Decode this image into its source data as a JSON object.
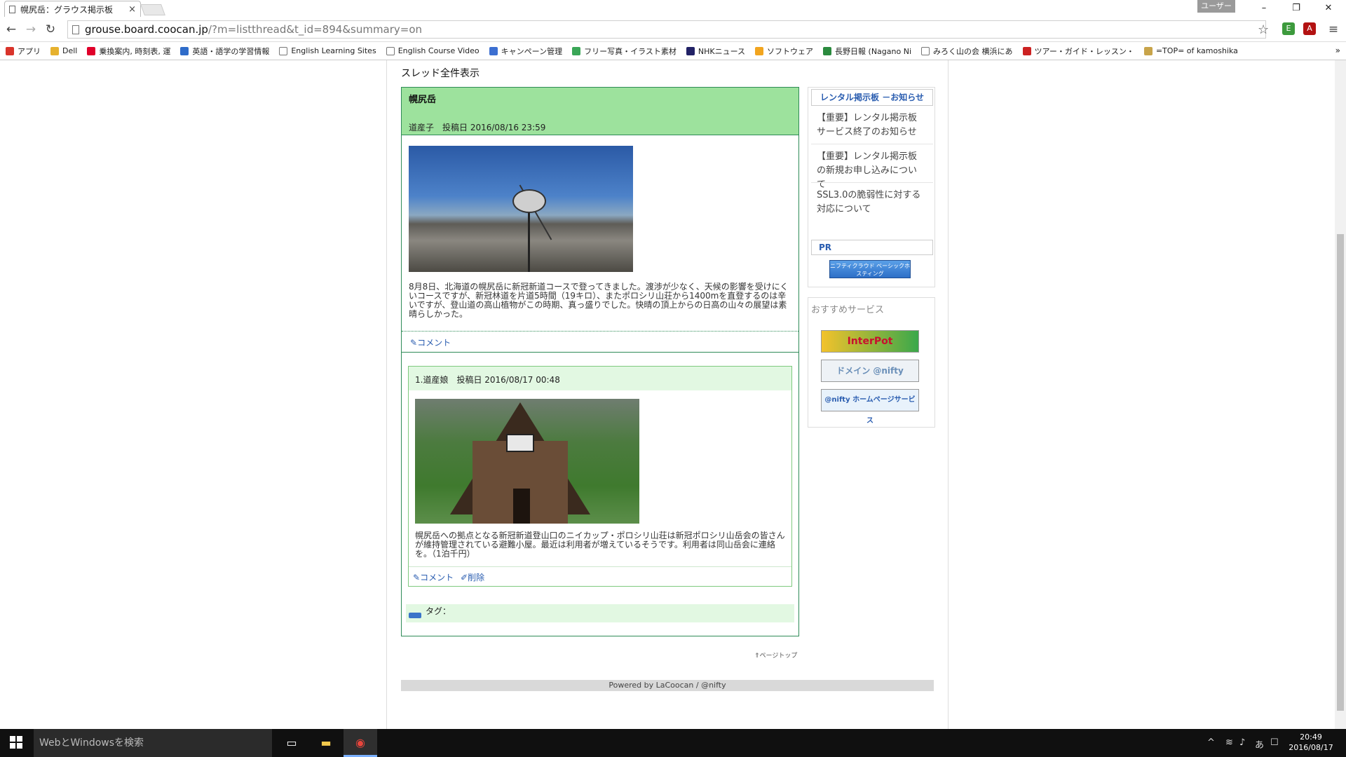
{
  "browser": {
    "tab_title": "幌尻岳：グラウス掲示板",
    "tab_close": "×",
    "user_badge": "ユーザー 1",
    "url_host": "grouse.board.coocan.jp",
    "url_path": "/?m=listthread&t_id=894&summary=on",
    "window_controls": {
      "minimize": "–",
      "restore": "❐",
      "close": "✕"
    },
    "bookmarks": [
      {
        "label": "アプリ",
        "color": "#d9342b"
      },
      {
        "label": "Dell",
        "color": "#e6b12e"
      },
      {
        "label": "乗換案内, 時刻表, 運",
        "color": "#e0002a"
      },
      {
        "label": "英語・語学の学習情報",
        "color": "#2f6cc9"
      },
      {
        "label": "English Learning Sites",
        "color": "#ffffff"
      },
      {
        "label": "English Course Video",
        "color": "#ffffff"
      },
      {
        "label": "キャンペーン管理",
        "color": "#3c6fd1"
      },
      {
        "label": "フリー写真・イラスト素材",
        "color": "#3aa657"
      },
      {
        "label": "NHKニュース",
        "color": "#222266"
      },
      {
        "label": "ソフトウェア",
        "color": "#f2a51f"
      },
      {
        "label": "長野日報 (Nagano Ni",
        "color": "#2b8a3e"
      },
      {
        "label": "みろく山の会 横浜にあ",
        "color": "#ffffff"
      },
      {
        "label": "ツアー・ガイド・レッスン・",
        "color": "#cc2222"
      },
      {
        "label": "=TOP= of kamoshika",
        "color": "#c8a44a"
      }
    ],
    "bookmarks_more": "»"
  },
  "page": {
    "heading": "スレッド全件表示",
    "thread": {
      "title": "幌尻岳",
      "meta": "道産子　投稿日 2016/08/16 23:59",
      "body": "8月8日、北海道の幌尻岳に新冠新道コースで登ってきました。渡渉が少なく、天候の影響を受けにくいコースですが、新冠林道を片道5時間（19キロ）、またポロシリ山荘から1400mを直登するのは辛いですが、登山道の高山植物がこの時期、真っ盛りでした。快晴の頂上からの日高の山々の展望は素晴らしかった。",
      "comment_label": "コメント"
    },
    "reply": {
      "meta": "1.道産娘　投稿日 2016/08/17 00:48",
      "body": "幌尻岳への拠点となる新冠新道登山口のニイカップ・ポロシリ山荘は新冠ポロシリ山岳会の皆さんが維持管理されている避難小屋。最近は利用者が増えているそうです。利用者は同山岳会に連絡を。（1泊千円）",
      "comment_label": "コメント",
      "delete_label": "削除"
    },
    "tags_label": "タグ：",
    "page_top": "ページトップ",
    "powered": "Powered by LaCoocan / @nifty"
  },
  "sidebar": {
    "notice_title": "レンタル掲示板 －お知らせ",
    "notices": [
      "【重要】レンタル掲示板サービス終了のお知らせ",
      "【重要】レンタル掲示板の新規お申し込みについて",
      "SSL3.0の脆弱性に対する対応について"
    ],
    "pr_label": "PR",
    "pr_banner": "ニフティクラウド ベーシックホスティング",
    "services_title": "おすすめサービス",
    "services": [
      "InterPot",
      "ドメイン @nifty",
      "@nifty ホームページサービス"
    ]
  },
  "taskbar": {
    "search_placeholder": "WebとWindowsを検索",
    "time": "20:49",
    "date": "2016/08/17"
  },
  "colors": {
    "thread_header": "#9de29d",
    "reply_header": "#e2f8e2",
    "link": "#2a5db0",
    "border_green": "#2e8b57"
  }
}
